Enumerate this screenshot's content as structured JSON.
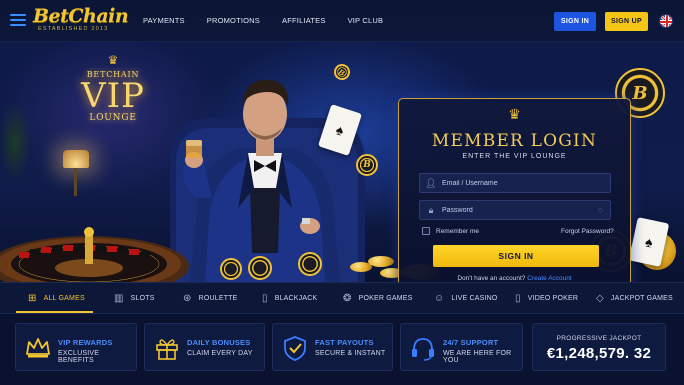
{
  "brand": {
    "logo_text": "BetChain",
    "logo_sub": "ESTABLISHED 2013"
  },
  "nav": {
    "items": [
      "PAYMENTS",
      "PROMOTIONS",
      "AFFILIATES",
      "VIP CLUB"
    ],
    "signin_label": "SIGN IN",
    "signup_label": "SIGN UP",
    "language_icon": "uk-flag-icon"
  },
  "hero": {
    "vip_sign": {
      "top": "BETCHAIN",
      "main": "VIP",
      "bottom": "LOUNGE"
    },
    "chip_letter": "B"
  },
  "login": {
    "title": "MEMBER LOGIN",
    "subtitle": "ENTER THE VIP LOUNGE",
    "username_placeholder": "Email / Username",
    "password_placeholder": "Password",
    "remember_label": "Remember me",
    "forgot_label": "Forgot Password?",
    "submit_label": "SIGN IN",
    "no_account_text": "Don't have an account?",
    "create_account_label": "Create Account"
  },
  "categories": [
    {
      "label": "ALL GAMES",
      "icon": "grid-icon",
      "active": true
    },
    {
      "label": "SLOTS",
      "icon": "slots-icon",
      "active": false
    },
    {
      "label": "ROULETTE",
      "icon": "roulette-icon",
      "active": false
    },
    {
      "label": "BLACKJACK",
      "icon": "cards-icon",
      "active": false
    },
    {
      "label": "POKER GAMES",
      "icon": "poker-chips-icon",
      "active": false
    },
    {
      "label": "LIVE CASINO",
      "icon": "dealer-icon",
      "active": false
    },
    {
      "label": "VIDEO POKER",
      "icon": "video-poker-icon",
      "active": false
    },
    {
      "label": "JACKPOT GAMES",
      "icon": "diamond-icon",
      "active": false
    }
  ],
  "features": [
    {
      "title": "VIP REWARDS",
      "subtitle": "EXCLUSIVE BENEFITS",
      "icon": "crown-icon"
    },
    {
      "title": "DAILY BONUSES",
      "subtitle": "CLAIM EVERY DAY",
      "icon": "gift-icon"
    },
    {
      "title": "FAST PAYOUTS",
      "subtitle": "SECURE & INSTANT",
      "icon": "shield-check-icon"
    },
    {
      "title": "24/7 SUPPORT",
      "subtitle": "WE ARE HERE FOR YOU",
      "icon": "headset-icon"
    }
  ],
  "jackpot": {
    "label": "PROGRESSIVE JACKPOT",
    "value": "€1,248,579. 32"
  },
  "colors": {
    "accent_gold": "#f3c531",
    "accent_blue": "#1e55e0",
    "background": "#0a1230"
  }
}
